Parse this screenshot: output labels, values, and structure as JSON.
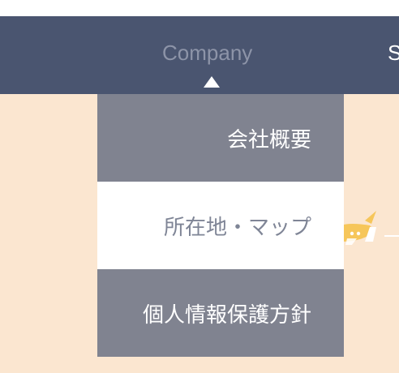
{
  "nav": {
    "company_label": "Company",
    "next_label": "S"
  },
  "dropdown": {
    "items": [
      {
        "label": "会社概要"
      },
      {
        "label": "所在地・マップ"
      },
      {
        "label": "個人情報保護方針"
      }
    ]
  },
  "colors": {
    "navbar": "#4a5570",
    "background": "#fbe6d0",
    "menu_item": "#808390",
    "menu_item_active": "#ffffff",
    "nav_active_text": "#8d94a8",
    "accent": "#f6c65a"
  },
  "icons": {
    "caret": "caret-up-icon",
    "plane": "airplane-illustration-icon"
  }
}
